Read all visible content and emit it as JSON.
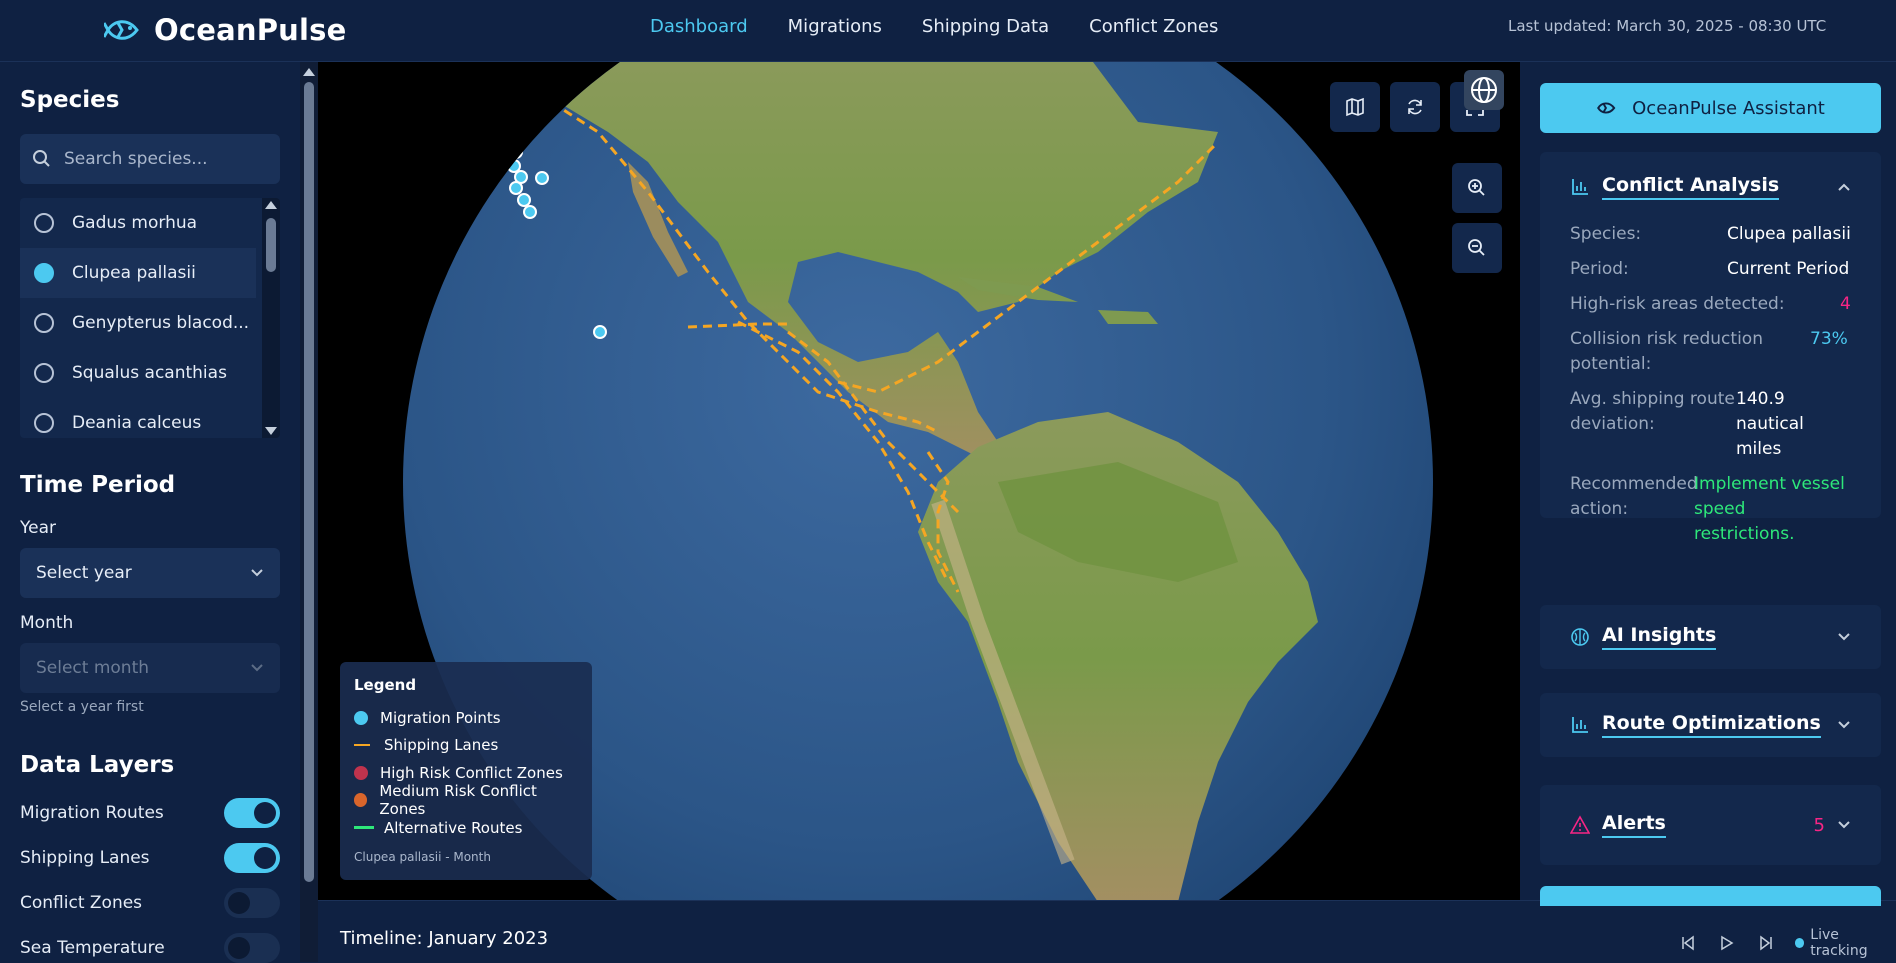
{
  "brand": {
    "name": "OceanPulse"
  },
  "nav": [
    {
      "label": "Dashboard",
      "active": true
    },
    {
      "label": "Migrations",
      "active": false
    },
    {
      "label": "Shipping Data",
      "active": false
    },
    {
      "label": "Conflict Zones",
      "active": false
    }
  ],
  "last_updated": "Last updated: March 30, 2025 - 08:30 UTC",
  "sidebar": {
    "species_title": "Species",
    "search_placeholder": "Search species...",
    "species": [
      {
        "name": "Gadus morhua",
        "selected": false
      },
      {
        "name": "Clupea pallasii",
        "selected": true
      },
      {
        "name": "Genypterus blacod...",
        "selected": false
      },
      {
        "name": "Squalus acanthias",
        "selected": false
      },
      {
        "name": "Deania calceus",
        "selected": false
      }
    ],
    "time_title": "Time Period",
    "year_label": "Year",
    "year_value": "Select year",
    "month_label": "Month",
    "month_value": "Select month",
    "month_hint": "Select a year first",
    "layers_title": "Data Layers",
    "layers": [
      {
        "label": "Migration Routes",
        "on": true
      },
      {
        "label": "Shipping Lanes",
        "on": true
      },
      {
        "label": "Conflict Zones",
        "on": false
      },
      {
        "label": "Sea Temperature",
        "on": false
      }
    ]
  },
  "legend": {
    "title": "Legend",
    "items": [
      {
        "label": "Migration Points",
        "kind": "dot",
        "color": "#4cc9f0"
      },
      {
        "label": "Shipping Lanes",
        "kind": "line",
        "color": "#f5a623"
      },
      {
        "label": "High Risk Conflict Zones",
        "kind": "dot",
        "color": "#c0334d"
      },
      {
        "label": "Medium Risk Conflict Zones",
        "kind": "dot",
        "color": "#d9652b"
      },
      {
        "label": "Alternative Routes",
        "kind": "line",
        "color": "#2ee87a"
      }
    ],
    "footer": "Clupea pallasii - Month"
  },
  "timeline": {
    "label": "Timeline: January 2023",
    "live_label": "Live tracking"
  },
  "right": {
    "assistant_label": "OceanPulse Assistant",
    "conflict": {
      "title": "Conflict Analysis",
      "species_k": "Species:",
      "species_v": "Clupea pallasii",
      "period_k": "Period:",
      "period_v": "Current Period",
      "risk_k": "High-risk areas detected:",
      "risk_v": "4",
      "reduction_k1": "Collision risk reduction",
      "reduction_k2": "potential:",
      "reduction_v": "73%",
      "dev_k1": "Avg. shipping route",
      "dev_k2": "deviation:",
      "dev_v1": "140.9",
      "dev_v2": "nautical",
      "dev_v3": "miles",
      "rec_k1": "Recommended",
      "rec_k2": "action:",
      "rec_v1": "Implement vessel",
      "rec_v2": "speed",
      "rec_v3": "restrictions."
    },
    "ai_title": "AI Insights",
    "route_title": "Route Optimizations",
    "alerts_title": "Alerts",
    "alerts_count": "5"
  },
  "colors": {
    "accent": "#4cc9f0",
    "danger": "#f72585",
    "success": "#2ee87a",
    "lane": "#f5a623"
  }
}
